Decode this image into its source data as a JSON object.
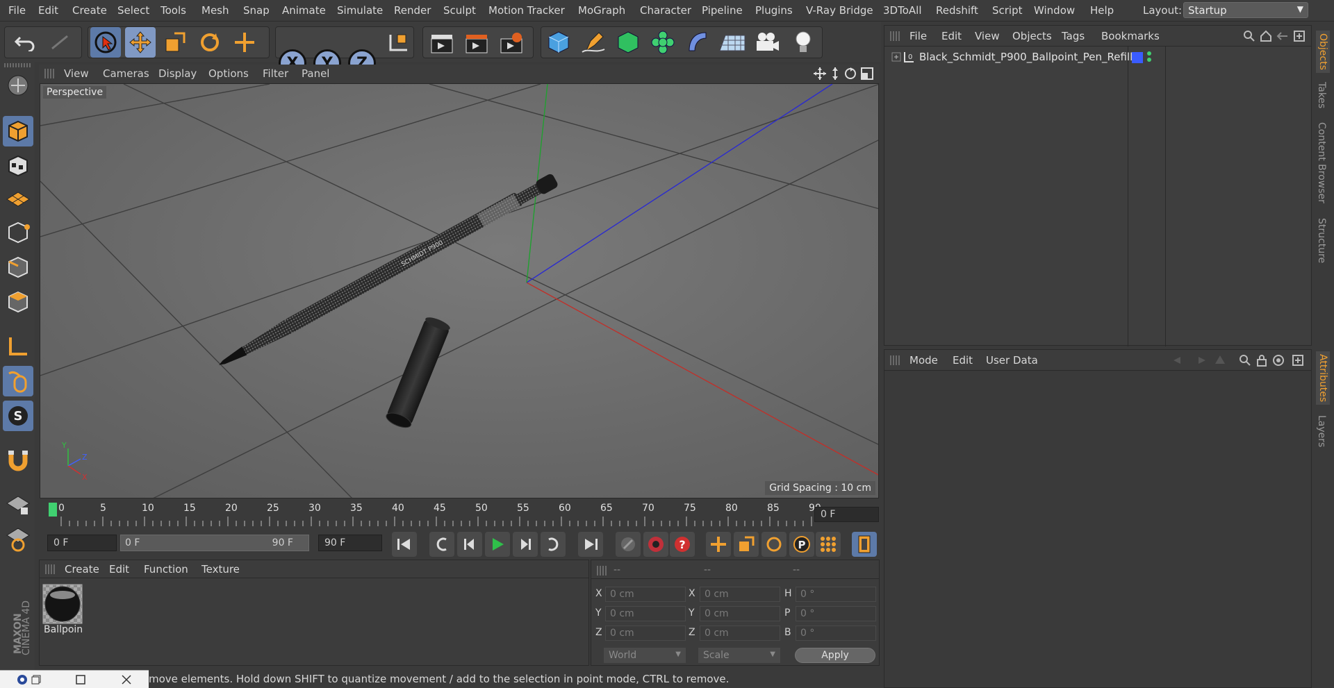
{
  "menu": {
    "items": [
      "File",
      "Edit",
      "Create",
      "Select",
      "Tools",
      "Mesh",
      "Snap",
      "Animate",
      "Simulate",
      "Render",
      "Sculpt",
      "Motion Tracker",
      "MoGraph",
      "Character",
      "Pipeline",
      "Plugins",
      "V-Ray Bridge",
      "3DToAll",
      "Redshift",
      "Script",
      "Window",
      "Help"
    ],
    "layout_label": "Layout:",
    "layout_value": "Startup"
  },
  "viewport": {
    "menu": [
      "View",
      "Cameras",
      "Display",
      "Options",
      "Filter",
      "Panel"
    ],
    "label": "Perspective",
    "grid_spacing": "Grid Spacing : 10 cm",
    "axes": {
      "y": "Y",
      "z": "Z",
      "x": "X"
    }
  },
  "timeline": {
    "ticks": [
      "0",
      "5",
      "10",
      "15",
      "20",
      "25",
      "30",
      "35",
      "40",
      "45",
      "50",
      "55",
      "60",
      "65",
      "70",
      "75",
      "80",
      "85",
      "90"
    ],
    "current_frame": "0 F",
    "start_field": "0 F",
    "range_start": "0 F",
    "range_end": "90 F",
    "end_field": "90 F"
  },
  "materials": {
    "menu": [
      "Create",
      "Edit",
      "Function",
      "Texture"
    ],
    "items": [
      {
        "name": "Ballpoin"
      }
    ]
  },
  "coords": {
    "headers": [
      "--",
      "--",
      "--"
    ],
    "rows": [
      {
        "l1": "X",
        "v1": "0 cm",
        "l2": "X",
        "v2": "0 cm",
        "l3": "H",
        "v3": "0 °"
      },
      {
        "l1": "Y",
        "v1": "0 cm",
        "l2": "Y",
        "v2": "0 cm",
        "l3": "P",
        "v3": "0 °"
      },
      {
        "l1": "Z",
        "v1": "0 cm",
        "l2": "Z",
        "v2": "0 cm",
        "l3": "B",
        "v3": "0 °"
      }
    ],
    "world": "World",
    "scale": "Scale",
    "apply": "Apply"
  },
  "objects": {
    "menu": [
      "File",
      "Edit",
      "View",
      "Objects",
      "Tags",
      "Bookmarks"
    ],
    "items": [
      {
        "name": "Black_Schmidt_P900_Ballpoint_Pen_Refill",
        "color": "#3a5cff"
      }
    ]
  },
  "attributes": {
    "menu": [
      "Mode",
      "Edit",
      "User Data"
    ]
  },
  "right_tabs": [
    "Objects",
    "Takes",
    "Content Browser",
    "Structure",
    "Attributes",
    "Layers"
  ],
  "status": "move elements. Hold down SHIFT to quantize movement / add to the selection in point mode, CTRL to remove.",
  "branding": {
    "line1": "MAXON",
    "line2": "CINEMA 4D"
  },
  "colors": {
    "accent": "#5d7aa8",
    "orange": "#f0a030",
    "play": "#2fbf4a",
    "record": "#c0303a"
  }
}
